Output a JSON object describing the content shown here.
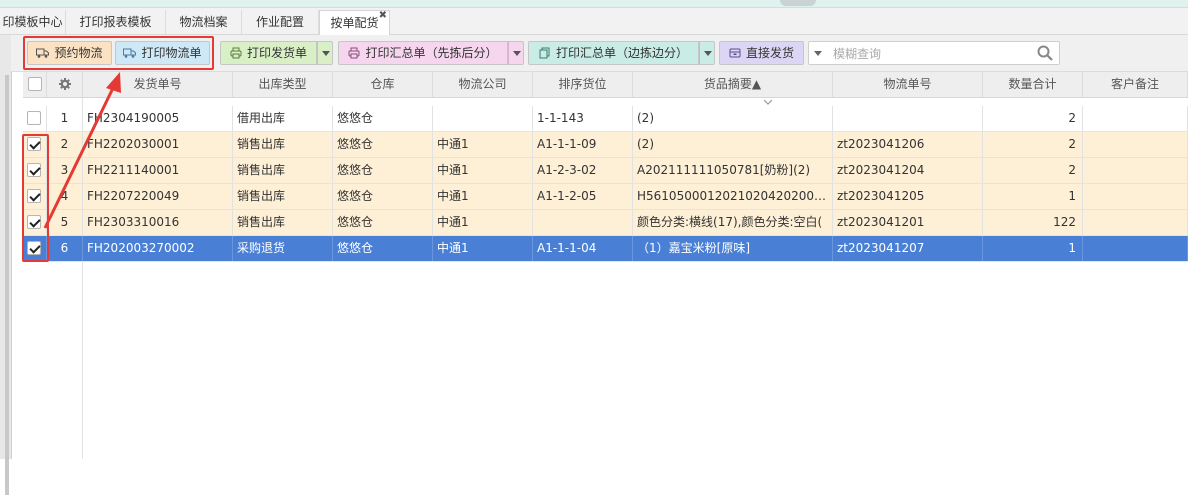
{
  "tabs": [
    {
      "label": "印模板中心",
      "active": false
    },
    {
      "label": "打印报表模板",
      "active": false
    },
    {
      "label": "物流档案",
      "active": false
    },
    {
      "label": "作业配置",
      "active": false
    },
    {
      "label": "按单配货",
      "active": true
    }
  ],
  "tab_close_symbol": "✖",
  "toolbar": {
    "book_logistics": "预约物流",
    "print_logistics": "打印物流单",
    "print_delivery": "打印发货单",
    "print_summary_first": "打印汇总单（先拣后分）",
    "print_summary_pick": "打印汇总单（边拣边分）",
    "direct_ship": "直接发货",
    "search_placeholder": "模糊查询"
  },
  "icons": {
    "book_logistics": "truck-outline-icon",
    "print_logistics": "truck-icon",
    "print_delivery": "printer-icon",
    "print_summary_first": "printer-icon",
    "print_summary_pick": "copy-icon",
    "direct_ship": "box-icon",
    "search": "search-icon",
    "settings": "gear-icon"
  },
  "colors": {
    "btn_orange": "#fbe2c3",
    "btn_blue": "#cfe8f5",
    "btn_green": "#d9f0c6",
    "btn_pink": "#f6d6ee",
    "btn_cyan": "#c9ede6",
    "btn_purple": "#dcd6f4",
    "selected_row": "#fdf0d6",
    "current_row": "#4a7fd6",
    "annotation_red": "#e53935"
  },
  "table": {
    "columns": [
      "发货单号",
      "出库类型",
      "仓库",
      "物流公司",
      "排序货位",
      "货品摘要▲",
      "物流单号",
      "数量合计",
      "客户备注"
    ],
    "rows": [
      {
        "idx": "1",
        "checked": false,
        "state": "normal",
        "cells": [
          "FH2304190005",
          "借用出库",
          "悠悠仓",
          "",
          "1-1-143",
          "(2)",
          "",
          "2",
          ""
        ]
      },
      {
        "idx": "2",
        "checked": true,
        "state": "selected",
        "cells": [
          "FH2202030001",
          "销售出库",
          "悠悠仓",
          "中通1",
          "A1-1-1-09",
          "(2)",
          "zt2023041206",
          "2",
          ""
        ]
      },
      {
        "idx": "3",
        "checked": true,
        "state": "selected",
        "cells": [
          "FH2211140001",
          "销售出库",
          "悠悠仓",
          "中通1",
          "A1-2-3-02",
          "A202111111050781[奶粉](2)",
          "zt2023041204",
          "2",
          ""
        ]
      },
      {
        "idx": "4",
        "checked": true,
        "state": "selected",
        "cells": [
          "FH2207220049",
          "销售出库",
          "悠悠仓",
          "中通1",
          "A1-1-2-05",
          "H56105000120210204202000000",
          "zt2023041205",
          "1",
          ""
        ]
      },
      {
        "idx": "5",
        "checked": true,
        "state": "selected",
        "cells": [
          "FH2303310016",
          "销售出库",
          "悠悠仓",
          "中通1",
          "",
          "颜色分类:横线(17),颜色分类:空白(",
          "zt2023041201",
          "122",
          ""
        ]
      },
      {
        "idx": "6",
        "checked": true,
        "state": "current",
        "cells": [
          "FH202003270002",
          "采购退货",
          "悠悠仓",
          "中通1",
          "A1-1-1-04",
          "（1）嘉宝米粉[原味]",
          "zt2023041207",
          "1",
          ""
        ]
      }
    ]
  }
}
